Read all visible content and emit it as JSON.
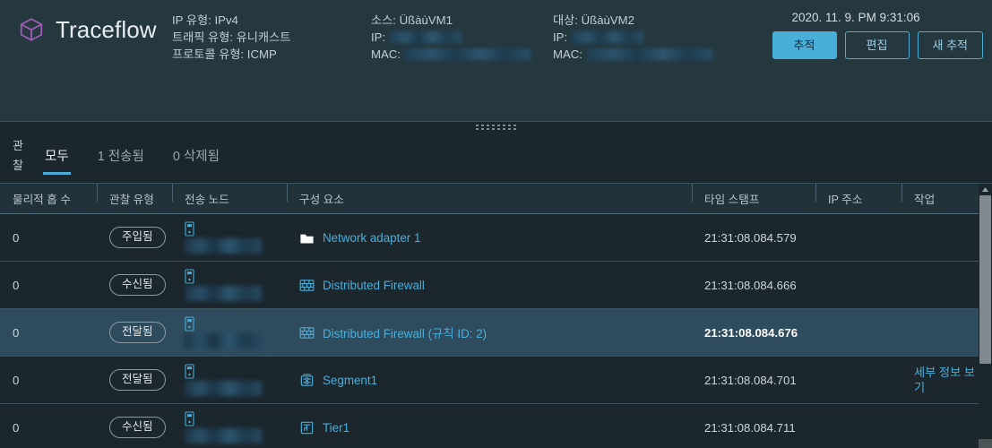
{
  "header": {
    "brand": {
      "title": "Traceflow",
      "icon": "cube-icon"
    },
    "flow_meta": [
      {
        "label": "IP 유형:",
        "value": "IPv4"
      },
      {
        "label": "트래픽 유형:",
        "value": "유니캐스트"
      },
      {
        "label": "프로토콜 유형:",
        "value": "ICMP"
      }
    ],
    "source": {
      "label": "소스:",
      "name": "ÜßàùVM1",
      "ip_label": "IP:",
      "ip_value": "",
      "mac_label": "MAC:",
      "mac_value": ""
    },
    "destination": {
      "label": "대상:",
      "name": "ÜßàùVM2",
      "ip_label": "IP:",
      "ip_value": "",
      "mac_label": "MAC:",
      "mac_value": ""
    },
    "timestamp": "2020. 11. 9. PM 9:31:06",
    "buttons": [
      {
        "label": "추적",
        "style": "primary"
      },
      {
        "label": "편집",
        "style": "ghost"
      },
      {
        "label": "새 추적",
        "style": "ghost"
      }
    ]
  },
  "observations": {
    "section_label": "관찰",
    "tabs": [
      {
        "label": "모두",
        "active": true
      },
      {
        "label": "1 전송됨",
        "active": false
      },
      {
        "label": "0 삭제됨",
        "active": false
      }
    ]
  },
  "table": {
    "columns": [
      {
        "key": "hop",
        "label": "물리적 홉 수"
      },
      {
        "key": "type",
        "label": "관찰 유형"
      },
      {
        "key": "node",
        "label": "전송 노드"
      },
      {
        "key": "comp",
        "label": "구성 요소"
      },
      {
        "key": "time",
        "label": "타임 스탬프"
      },
      {
        "key": "ip",
        "label": "IP 주소"
      },
      {
        "key": "act",
        "label": "작업"
      }
    ],
    "rows": [
      {
        "hop": "0",
        "type": "주입됨",
        "node": "",
        "node_icon": "server-icon",
        "component": "Network adapter 1",
        "component_icon": "network-adapter-icon",
        "timestamp": "21:31:08.084.579",
        "ip": "",
        "action": "",
        "selected": false
      },
      {
        "hop": "0",
        "type": "수신됨",
        "node": "",
        "node_icon": "server-icon",
        "component": "Distributed Firewall",
        "component_icon": "firewall-icon",
        "timestamp": "21:31:08.084.666",
        "ip": "",
        "action": "",
        "selected": false
      },
      {
        "hop": "0",
        "type": "전달됨",
        "node": "",
        "node_icon": "server-icon",
        "component": "Distributed Firewall (규칙 ID: 2)",
        "component_icon": "firewall-icon",
        "timestamp": "21:31:08.084.676",
        "ip": "",
        "action": "",
        "selected": true
      },
      {
        "hop": "0",
        "type": "전달됨",
        "node": "",
        "node_icon": "server-icon",
        "component": "Segment1",
        "component_icon": "segment-icon",
        "timestamp": "21:31:08.084.701",
        "ip": "",
        "action": "세부 정보 보기",
        "selected": false
      },
      {
        "hop": "0",
        "type": "수신됨",
        "node": "",
        "node_icon": "server-icon",
        "component": "Tier1",
        "component_icon": "tier-router-icon",
        "timestamp": "21:31:08.084.711",
        "ip": "",
        "action": "",
        "selected": false
      }
    ]
  },
  "colors": {
    "accent": "#49afd9",
    "brand_icon": "#a05fb4",
    "panel_bg": "#253840",
    "body_bg": "#1b262d",
    "selected_row": "#2f4c5f"
  }
}
